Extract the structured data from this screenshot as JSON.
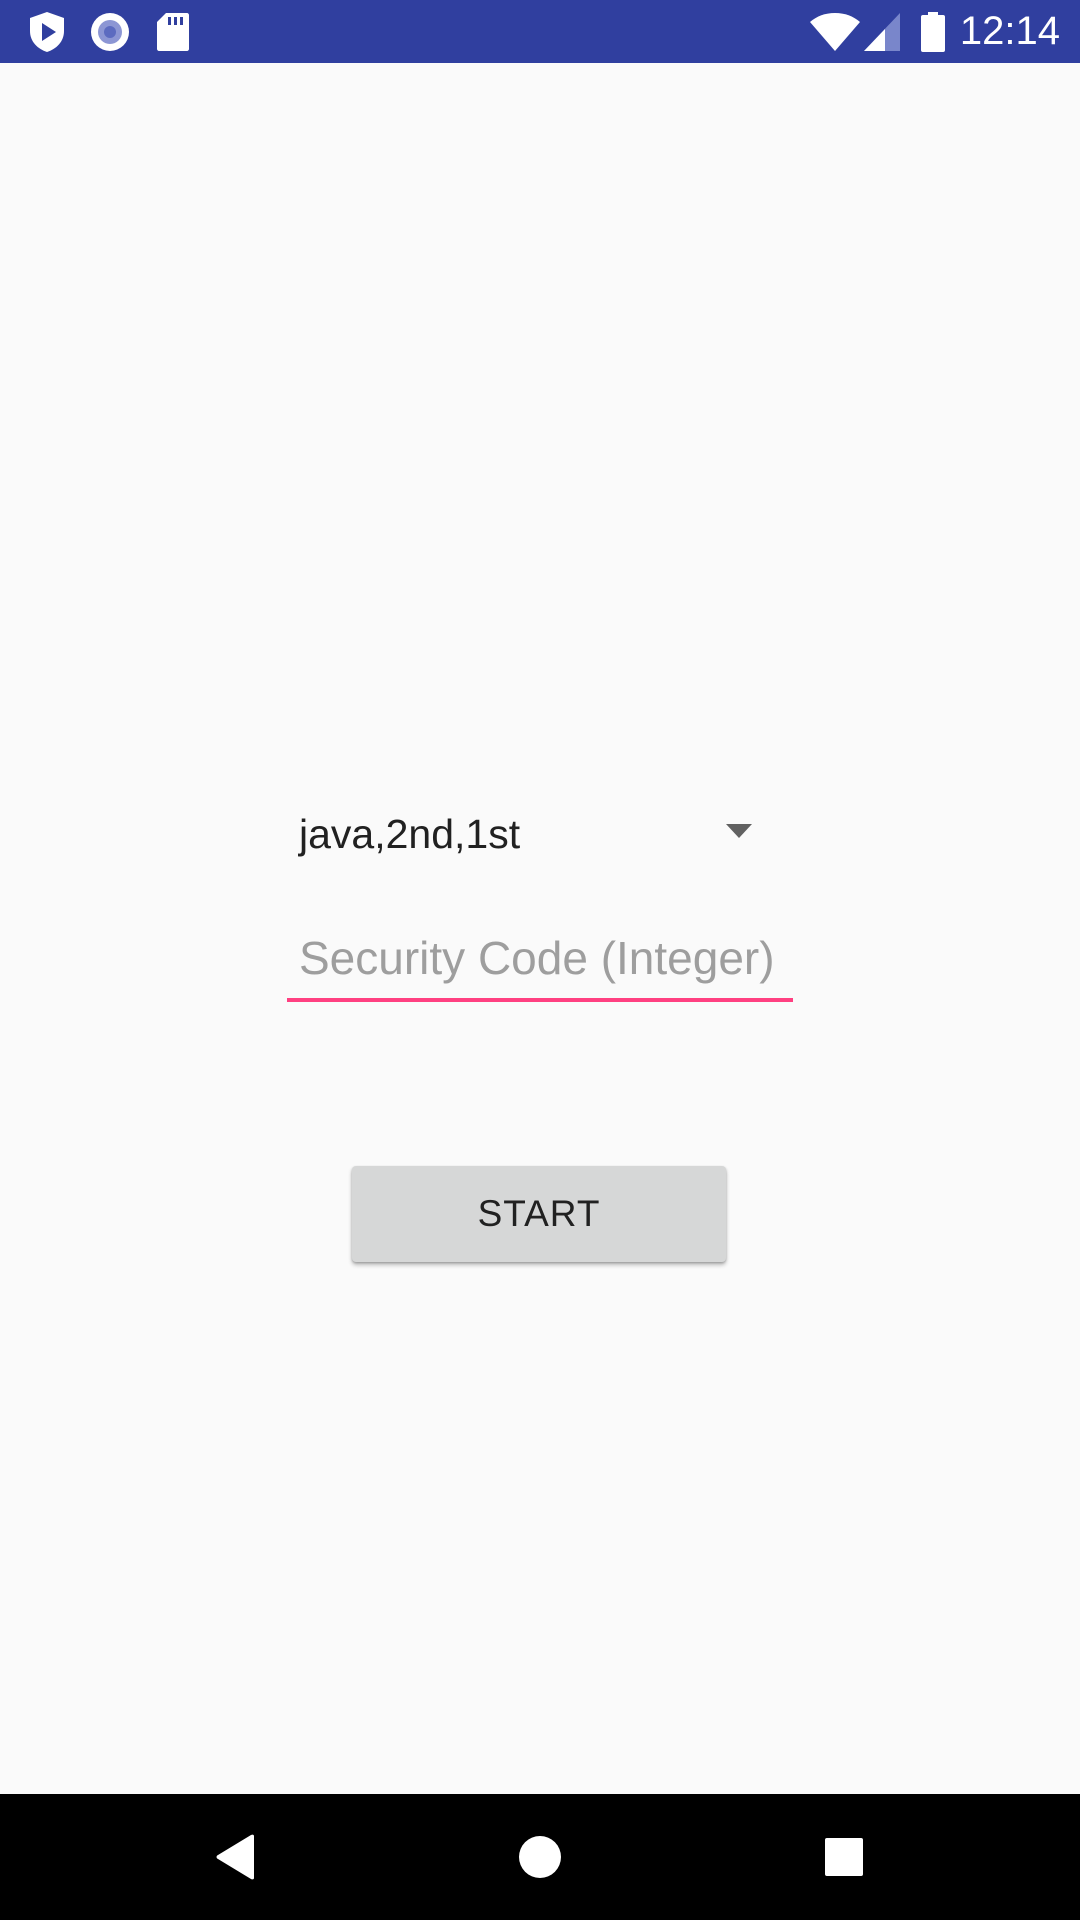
{
  "status_bar": {
    "time": "12:14",
    "left_icons": [
      "shield-play-icon",
      "record-icon",
      "sd-card-icon"
    ],
    "right_icons": [
      "wifi-icon",
      "signal-icon",
      "battery-icon"
    ],
    "background": "#303f9f"
  },
  "form": {
    "spinner": {
      "selected_value": "java,2nd,1st"
    },
    "security_code": {
      "value": "",
      "placeholder": "Security Code (Integer)",
      "underline_color": "#ff4081"
    },
    "start_label": "START"
  },
  "nav_bar": {
    "buttons": [
      "back-icon",
      "home-icon",
      "recents-icon"
    ]
  }
}
